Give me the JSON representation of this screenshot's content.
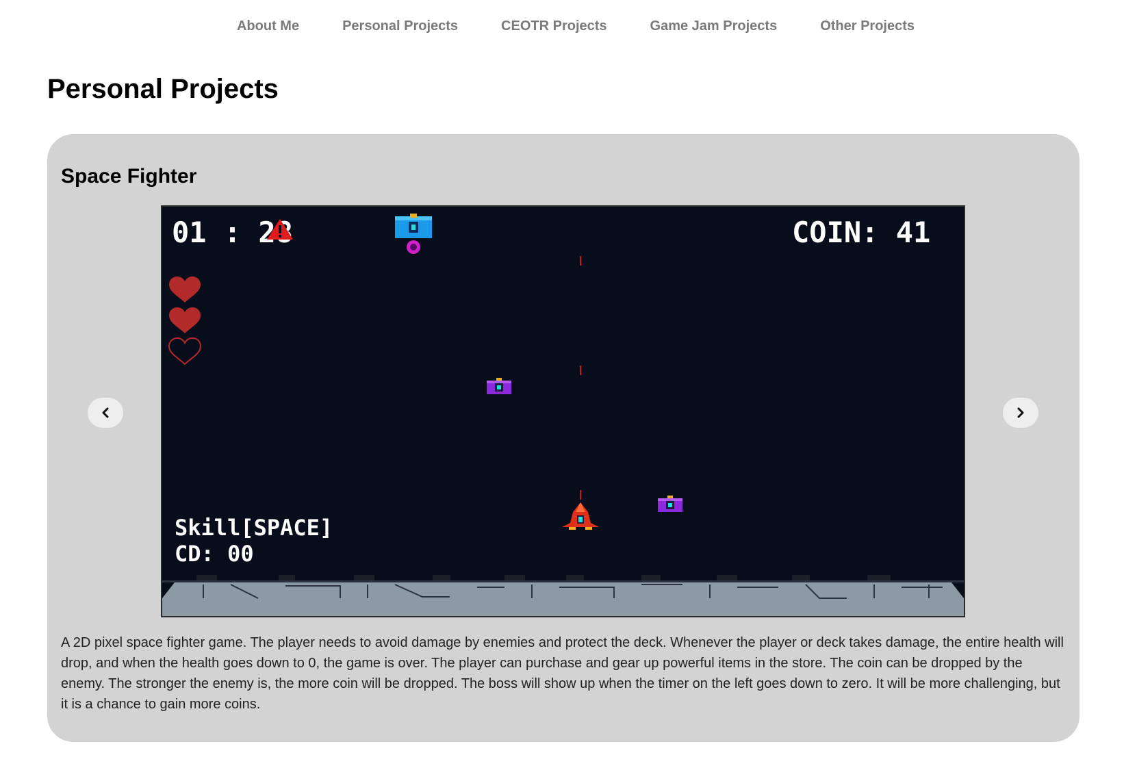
{
  "nav": {
    "items": [
      {
        "label": "About Me"
      },
      {
        "label": "Personal Projects"
      },
      {
        "label": "CEOTR Projects"
      },
      {
        "label": "Game Jam Projects"
      },
      {
        "label": "Other Projects"
      }
    ]
  },
  "page": {
    "title": "Personal Projects"
  },
  "project": {
    "title": "Space Fighter",
    "description": "A 2D pixel space fighter game. The player needs to avoid damage by enemies and protect the deck. Whenever the player or deck takes damage, the entire health will drop, and when the health goes down to 0, the game is over. The player can purchase and gear up powerful items in the store. The coin can be dropped by the enemy. The stronger the enemy is, the more coin will be dropped. The boss will show up when the timer on the left goes down to zero. It will be more challenging, but it is a chance to gain more coins."
  },
  "game": {
    "timer": "01 : 28",
    "coin_label": "COIN: 41",
    "skill_label": "Skill[SPACE]",
    "cooldown_label": "CD: 00",
    "hearts_total": 3,
    "hearts_filled": 2,
    "colors": {
      "background": "#070d1a",
      "heart": "#b22a2a",
      "laser": "#d01818",
      "deck": "#8c9aa4"
    }
  },
  "carousel": {
    "prev_icon": "chevron-left-icon",
    "next_icon": "chevron-right-icon"
  }
}
